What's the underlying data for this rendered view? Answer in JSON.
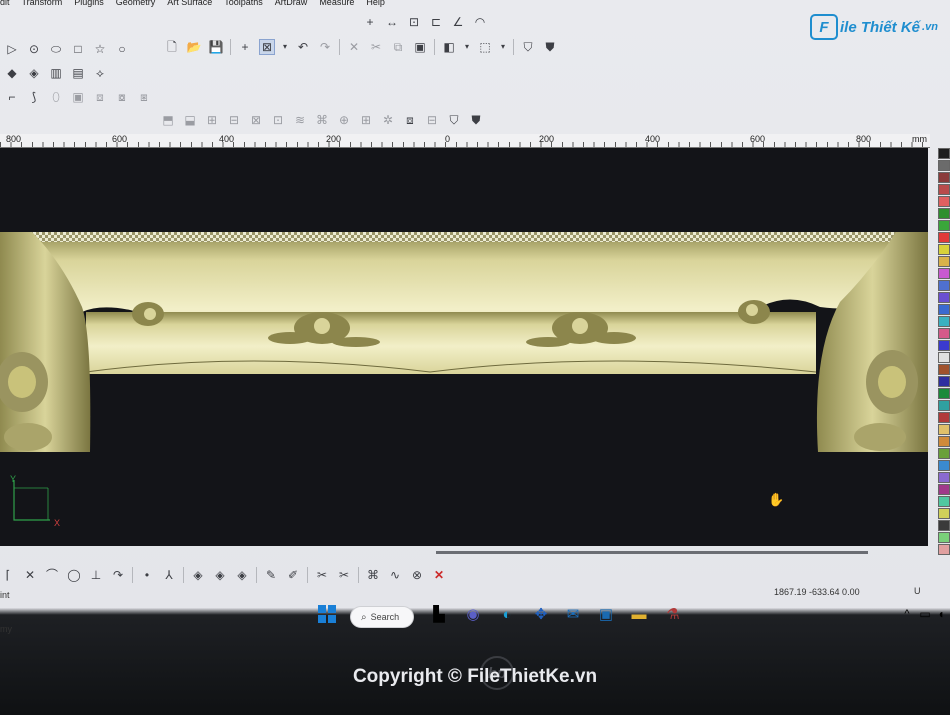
{
  "menu": [
    "dit",
    "Transform",
    "Plugins",
    "Geometry",
    "Art Surface",
    "Toolpaths",
    "ArtDraw",
    "Measure",
    "Help"
  ],
  "logo": {
    "letter": "F",
    "text": "ile Thiết Kế",
    "suffix": ".vn"
  },
  "ruler": {
    "labels": [
      "800",
      "600",
      "400",
      "200",
      "0",
      "200",
      "400",
      "600",
      "800",
      "mm"
    ]
  },
  "status": {
    "left_text": "int",
    "left_text_2": "my",
    "coords": "1867.19 -633.64 0.00",
    "unit": "U"
  },
  "taskbar": {
    "search_placeholder": "Search"
  },
  "footer": {
    "copyright": "Copyright © FileThietKe.vn",
    "brand": "hp"
  },
  "colors": {
    "accent": "#1f8ecf",
    "canvas": "#131418",
    "relief": "#c9c27a",
    "palette": [
      "#1e1e1e",
      "#6b6b6b",
      "#8a3b3b",
      "#b94b4b",
      "#e06060",
      "#2f8f2f",
      "#3aa63a",
      "#e03a3a",
      "#d7d23a",
      "#d9b24a",
      "#c85ad0",
      "#4f70d0",
      "#6a4fd0",
      "#3a6ad0",
      "#3ab0c0",
      "#d45a8a",
      "#3a3ad0",
      "#e0e0e0",
      "#a0522d",
      "#2f2fa0",
      "#1a8a3a",
      "#2fa0a0",
      "#b03a3a",
      "#e0c06a",
      "#d08a3a",
      "#6aa03a",
      "#3a8ad0",
      "#8a6ad0",
      "#a03a8a",
      "#50c8a0",
      "#d0d05a",
      "#3a3a3a",
      "#7ad07a",
      "#e0a0a0"
    ]
  }
}
